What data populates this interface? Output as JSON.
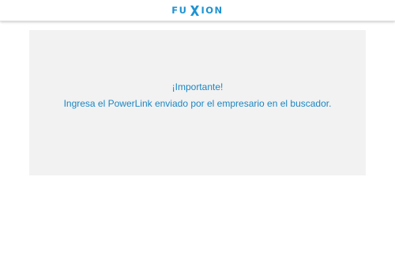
{
  "header": {
    "logo": {
      "text_before_x": "FU",
      "x_letter": "X",
      "text_after_x": "ION"
    }
  },
  "notice": {
    "title": "¡Importante!",
    "message": "Ingresa el PowerLink enviado por el empresario en el buscador."
  },
  "colors": {
    "brand_blue": "#1f93d2",
    "text_blue": "#1b86c3",
    "panel_background": "#f2f2f2",
    "page_background": "#ffffff"
  }
}
